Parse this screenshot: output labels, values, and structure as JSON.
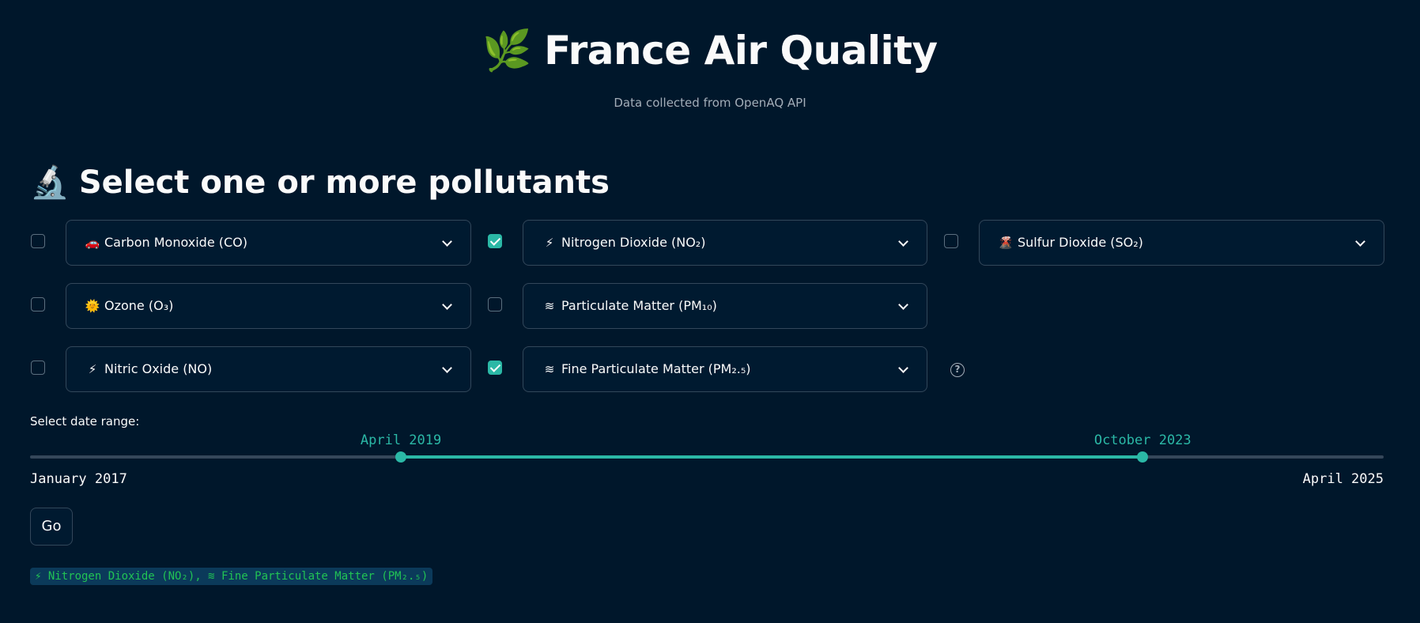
{
  "header": {
    "icon": "🌿",
    "icon_name": "herb-icon",
    "title": "France Air Quality",
    "subtitle": "Data collected from OpenAQ API"
  },
  "section": {
    "icon": "🔬",
    "icon_name": "microscope-icon",
    "title": "Select one or more pollutants"
  },
  "pollutants": [
    {
      "id": "co",
      "icon": "🚗",
      "icon_name": "car-icon",
      "label": "Carbon Monoxide (CO)",
      "checked": false
    },
    {
      "id": "no2",
      "icon": "⚡",
      "icon_name": "lightning-icon",
      "label": "Nitrogen Dioxide (NO₂)",
      "checked": true
    },
    {
      "id": "so2",
      "icon": "🌋",
      "icon_name": "volcano-icon",
      "label": "Sulfur Dioxide (SO₂)",
      "checked": false
    },
    {
      "id": "o3",
      "icon": "🌞",
      "icon_name": "sun-icon",
      "label": "Ozone (O₃)",
      "checked": false
    },
    {
      "id": "pm10",
      "icon": "≋",
      "icon_name": "wave-icon",
      "label": "Particulate Matter (PM₁₀)",
      "checked": false
    },
    {
      "id": "no",
      "icon": "⚡",
      "icon_name": "lightning-icon",
      "label": "Nitric Oxide (NO)",
      "checked": false
    },
    {
      "id": "pm25",
      "icon": "≋",
      "icon_name": "wave-icon",
      "label": "Fine Particulate Matter (PM₂.₅)",
      "checked": true
    }
  ],
  "help_icon": "?",
  "date_range": {
    "label": "Select date range:",
    "min_label": "January 2017",
    "max_label": "April 2025",
    "start_label": "April 2019",
    "end_label": "October 2023",
    "start_fraction": 0.274,
    "end_fraction": 0.822
  },
  "go_label": "Go",
  "selected_summary": "⚡ Nitrogen Dioxide (NO₂), ≋ Fine Particulate Matter (PM₂.₅)",
  "colors": {
    "background": "#00172b",
    "accent": "#2bb8a6",
    "summary_text": "#21c354"
  }
}
